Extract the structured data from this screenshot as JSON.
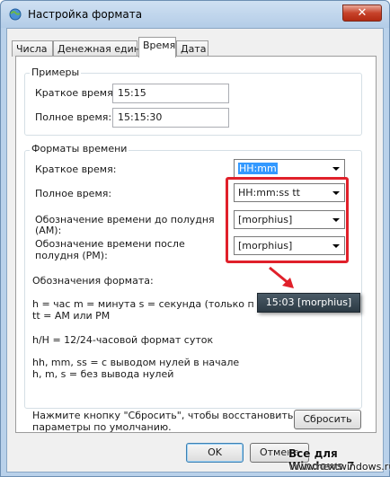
{
  "window": {
    "title": "Настройка формата",
    "close_glyph": "✕",
    "title_icon": "globe-icon"
  },
  "tabs": [
    {
      "label": "Числа"
    },
    {
      "label": "Денежная единица"
    },
    {
      "label": "Время",
      "active": true
    },
    {
      "label": "Дата"
    }
  ],
  "examples": {
    "label": "Примеры",
    "short_label": "Краткое время:",
    "short_value": "15:15",
    "long_label": "Полное время:",
    "long_value": "15:15:30"
  },
  "formats": {
    "label": "Форматы времени",
    "short_label": "Краткое время:",
    "short_value": "HH:mm",
    "long_label": "Полное время:",
    "long_value": "HH:mm:ss tt",
    "am_label_1": "Обозначение времени до полудня",
    "am_label_2": "(AM):",
    "am_value": "[morphius]",
    "pm_label_1": "Обозначение времени после",
    "pm_label_2": "полудня (PM):",
    "pm_value": "[morphius]"
  },
  "notation": {
    "title": "Обозначения формата:",
    "line1": "h = час   m = минута   s = секунда (только полное",
    "line2": "tt = AM или PM",
    "line3": "h/H = 12/24-часовой формат суток",
    "line4": "hh, mm, ss = с выводом нулей в начале",
    "line5": "h, m, s = без вывода нулей"
  },
  "reset": {
    "hint_1": "Нажмите кнопку \"Сбросить\", чтобы восстановить",
    "hint_2": "параметры по умолчанию.",
    "button": "Сбросить"
  },
  "tooltip": "15:03 [morphius]",
  "footer": {
    "ok": "OK",
    "cancel": "Отмена"
  },
  "watermark": {
    "line1": "Все для Windows 7",
    "line2": "www.nextwindows.ru"
  },
  "colors": {
    "highlight": "#e0202a",
    "selection": "#3399ff"
  }
}
